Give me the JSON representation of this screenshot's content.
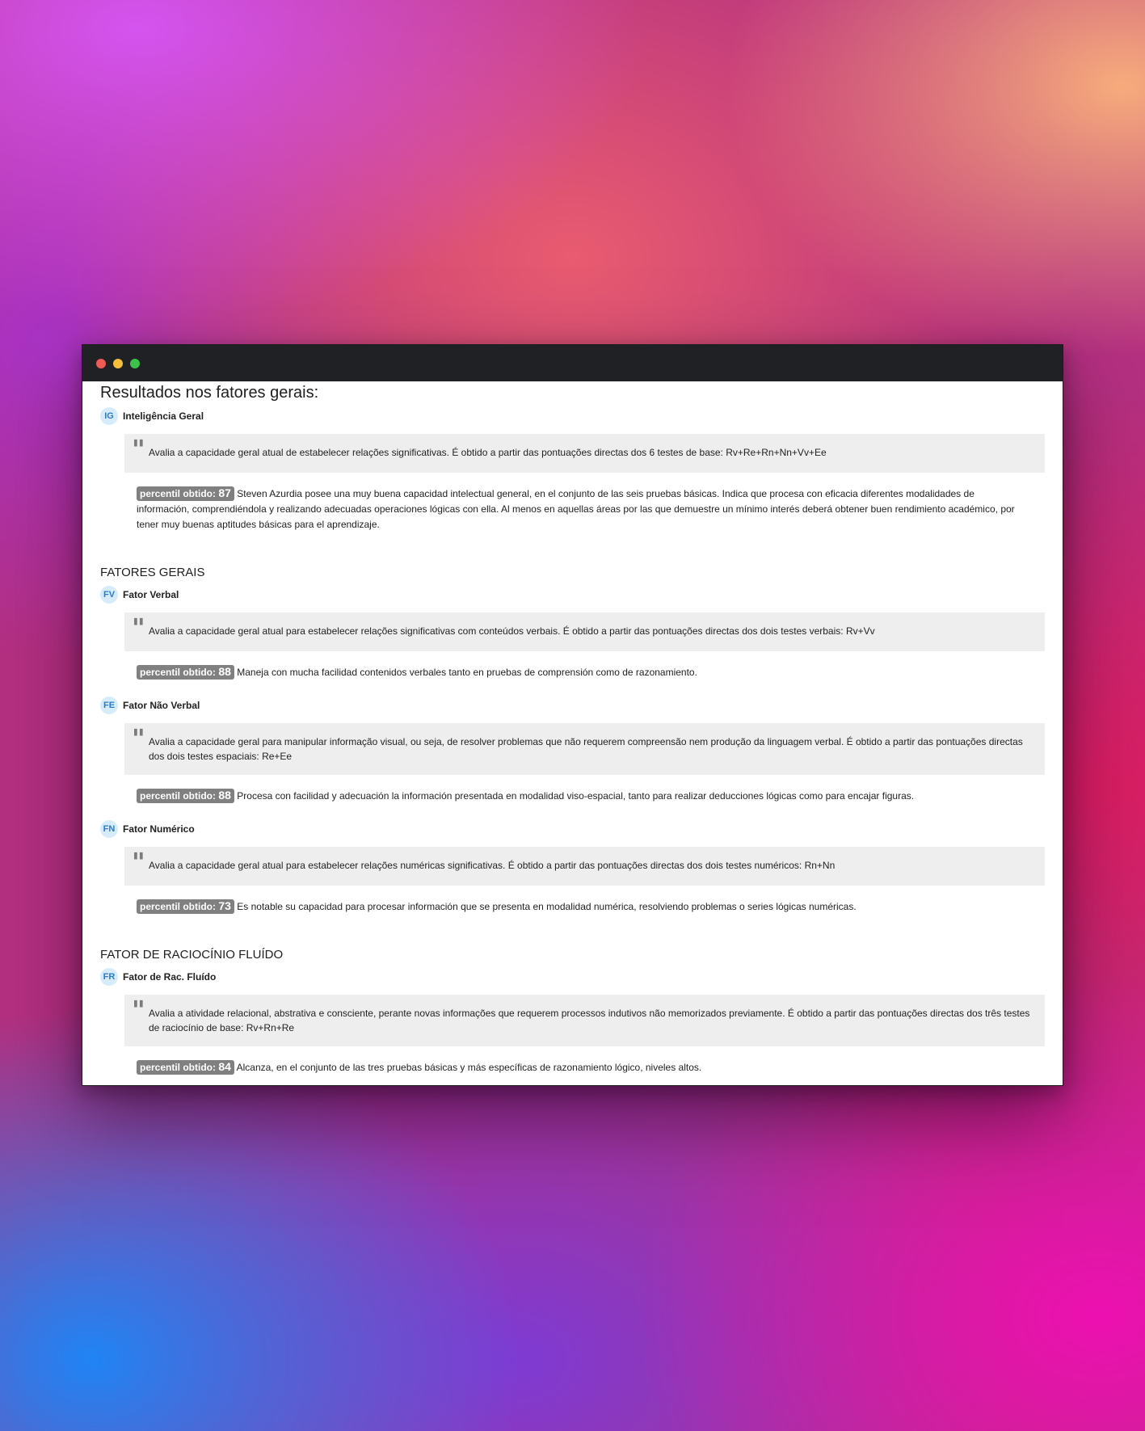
{
  "window": {
    "controls": [
      "close",
      "minimize",
      "maximize"
    ]
  },
  "main_title": "Resultados nos fatores gerais:",
  "percentile_label": "percentil obtido:",
  "general": {
    "abbr": "IG",
    "name": "Inteligência Geral",
    "description": "Avalia a capacidade geral atual de estabelecer relações significativas. É obtido a partir das pontuações directas dos 6 testes de base: Rv+Re+Rn+Nn+Vv+Ee",
    "percentile": "87",
    "result": "Steven Azurdia posee una muy buena capacidad intelectual general, en el conjunto de las seis pruebas básicas. Indica que procesa con eficacia diferentes modalidades de información, comprendiéndola y realizando adecuadas operaciones lógicas con ella. Al menos en aquellas áreas por las que demuestre un mínimo interés deberá obtener buen rendimiento académico, por tener muy buenas aptitudes básicas para el aprendizaje."
  },
  "sections": [
    {
      "title": "FATORES GERAIS",
      "factors": [
        {
          "abbr": "FV",
          "name": "Fator Verbal",
          "description": "Avalia a capacidade geral atual para estabelecer relações significativas com conteúdos verbais. É obtido a partir das pontuações directas dos dois testes verbais: Rv+Vv",
          "percentile": "88",
          "result": "Maneja con mucha facilidad contenidos verbales tanto en pruebas de comprensión como de razonamiento."
        },
        {
          "abbr": "FE",
          "name": "Fator Não Verbal",
          "description": "Avalia a capacidade geral para manipular informação visual, ou seja, de resolver problemas que não requerem compreensão nem produção da linguagem verbal. É obtido a partir das pontuações directas dos dois testes espaciais: Re+Ee",
          "percentile": "88",
          "result": "Procesa con facilidad y adecuación la información presentada en modalidad viso-espacial, tanto para realizar deducciones lógicas como para encajar figuras."
        },
        {
          "abbr": "FN",
          "name": "Fator Numérico",
          "description": "Avalia a capacidade geral atual para estabelecer relações numéricas significativas. É obtido a partir das pontuações directas dos dois testes numéricos: Rn+Nn",
          "percentile": "73",
          "result": "Es notable su capacidad para procesar información que se presenta en modalidad numérica, resolviendo problemas o series lógicas numéricas."
        }
      ]
    },
    {
      "title": "FATOR DE RACIOCÍNIO FLUÍDO",
      "factors": [
        {
          "abbr": "FR",
          "name": "Fator de Rac. Fluído",
          "description": "Avalia a atividade relacional, abstrativa e consciente, perante novas informações que requerem processos indutivos não memorizados previamente. É obtido a partir das pontuações directas dos três testes de raciocínio de base: Rv+Rn+Re",
          "percentile": "84",
          "result": "Alcanza, en el conjunto de las tres pruebas básicas y más específicas de razonamiento lógico, niveles altos."
        }
      ]
    }
  ]
}
